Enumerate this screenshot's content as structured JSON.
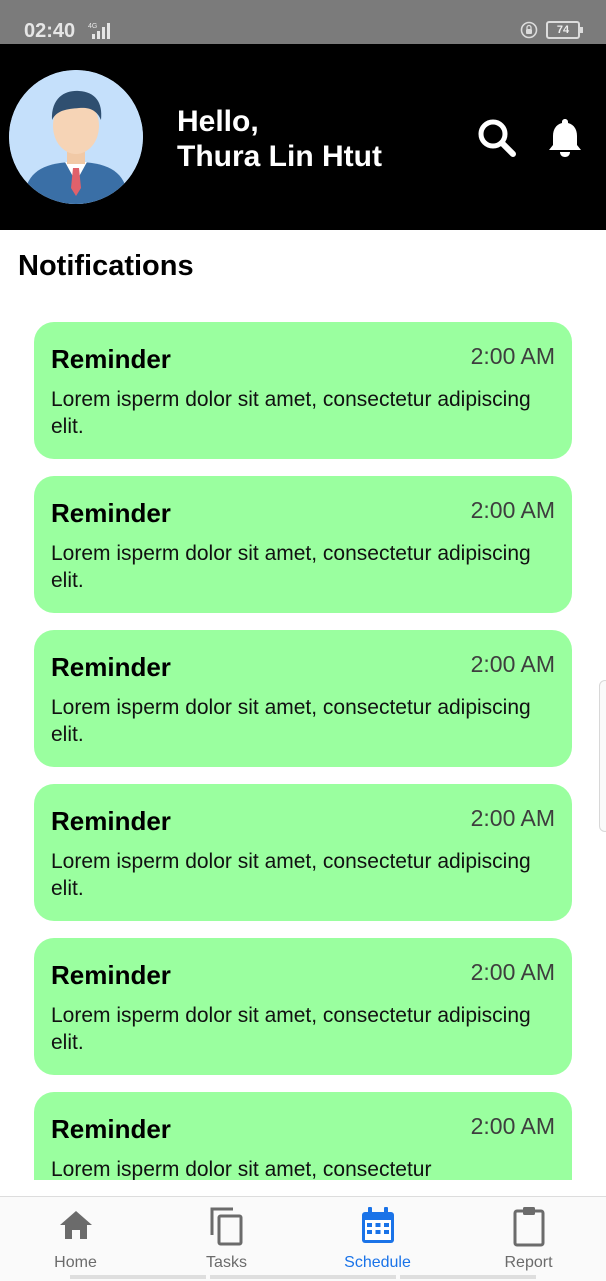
{
  "status_bar": {
    "time": "02:40",
    "network": "4G",
    "battery": "74"
  },
  "header": {
    "greeting_line1": "Hello,",
    "greeting_line2": "Thura Lin Htut"
  },
  "page": {
    "title": "Notifications"
  },
  "notifications": [
    {
      "title": "Reminder",
      "time": "2:00 AM",
      "body": "Lorem isperm dolor sit amet, consectetur adipiscing elit."
    },
    {
      "title": "Reminder",
      "time": "2:00 AM",
      "body": "Lorem isperm dolor sit amet, consectetur adipiscing elit."
    },
    {
      "title": "Reminder",
      "time": "2:00 AM",
      "body": "Lorem isperm dolor sit amet, consectetur adipiscing elit."
    },
    {
      "title": "Reminder",
      "time": "2:00 AM",
      "body": "Lorem isperm dolor sit amet, consectetur adipiscing elit."
    },
    {
      "title": "Reminder",
      "time": "2:00 AM",
      "body": "Lorem isperm dolor sit amet, consectetur adipiscing elit."
    },
    {
      "title": "Reminder",
      "time": "2:00 AM",
      "body": "Lorem isperm dolor sit amet, consectetur"
    }
  ],
  "bottom_nav": [
    {
      "label": "Home",
      "icon": "home-icon"
    },
    {
      "label": "Tasks",
      "icon": "copy-icon"
    },
    {
      "label": "Schedule",
      "icon": "calendar-icon",
      "active": true
    },
    {
      "label": "Report",
      "icon": "clipboard-icon"
    }
  ],
  "colors": {
    "card_bg": "#9aff9f",
    "header_bg": "#000000",
    "active_nav": "#1a73e8",
    "inactive_nav": "#6b6b6b"
  }
}
